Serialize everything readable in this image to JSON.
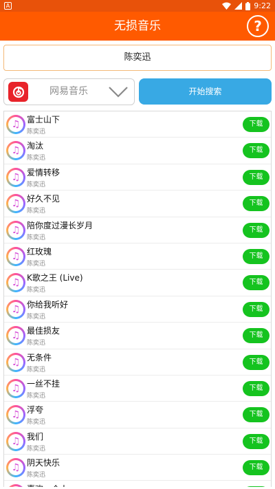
{
  "status": {
    "left_icon": "A",
    "time": "9:22"
  },
  "appbar": {
    "title": "无损音乐",
    "help_symbol": "?"
  },
  "search": {
    "query": "陈奕迅"
  },
  "source": {
    "label": "网易音乐",
    "icon": "netease-music-icon"
  },
  "search_button": {
    "label": "开始搜索"
  },
  "download_label": "下载",
  "songs": [
    {
      "title": "富士山下",
      "artist": "陈奕迅"
    },
    {
      "title": "淘汰",
      "artist": "陈奕迅"
    },
    {
      "title": "爱情转移",
      "artist": "陈奕迅"
    },
    {
      "title": "好久不见",
      "artist": "陈奕迅"
    },
    {
      "title": "陪你度过漫长岁月",
      "artist": "陈奕迅"
    },
    {
      "title": "红玫瑰",
      "artist": "陈奕迅"
    },
    {
      "title": "K歌之王 (Live)",
      "artist": "陈奕迅"
    },
    {
      "title": "你给我听好",
      "artist": "陈奕迅"
    },
    {
      "title": "最佳损友",
      "artist": "陈奕迅"
    },
    {
      "title": "无条件",
      "artist": "陈奕迅"
    },
    {
      "title": "一丝不挂",
      "artist": "陈奕迅"
    },
    {
      "title": "浮夸",
      "artist": "陈奕迅"
    },
    {
      "title": "我们",
      "artist": "陈奕迅"
    },
    {
      "title": "阴天快乐",
      "artist": "陈奕迅"
    },
    {
      "title": "喜欢一个人",
      "artist": ""
    }
  ],
  "colors": {
    "appbar": "#ff5a00",
    "search_button": "#38a9e4",
    "download": "#15c31f",
    "netease": "#e8232a"
  }
}
